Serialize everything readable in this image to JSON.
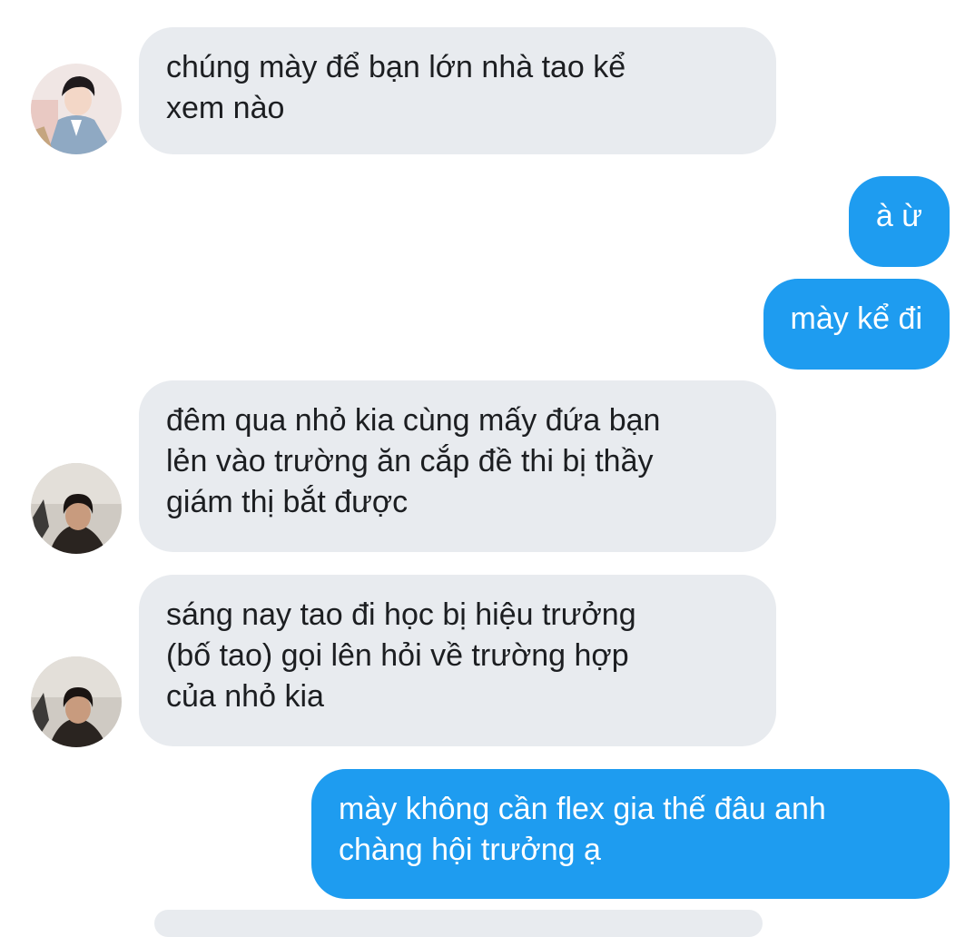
{
  "conversation": {
    "messages": [
      {
        "sender": "other",
        "avatar": "avatar-1",
        "text": "chúng mày để bạn lớn nhà tao kể\nxem nào"
      },
      {
        "sender": "me",
        "text": "à ừ"
      },
      {
        "sender": "me",
        "text": "mày kể đi"
      },
      {
        "sender": "other",
        "avatar": "avatar-2",
        "text": "đêm qua nhỏ kia cùng mấy đứa bạn\nlẻn vào trường ăn cắp đề thi bị thầy\ngiám thị bắt được"
      },
      {
        "sender": "other",
        "avatar": "avatar-2",
        "text": "sáng nay tao đi học bị hiệu trưởng\n(bố tao) gọi lên hỏi về trường hợp\ncủa nhỏ kia"
      },
      {
        "sender": "me",
        "text": "mày không cần flex gia thế đâu anh\nchàng hội trưởng ạ"
      }
    ]
  },
  "colors": {
    "incoming_bubble": "#e8ebef",
    "outgoing_bubble": "#1e9cf0",
    "incoming_text": "#1c1e21",
    "outgoing_text": "#ffffff"
  }
}
